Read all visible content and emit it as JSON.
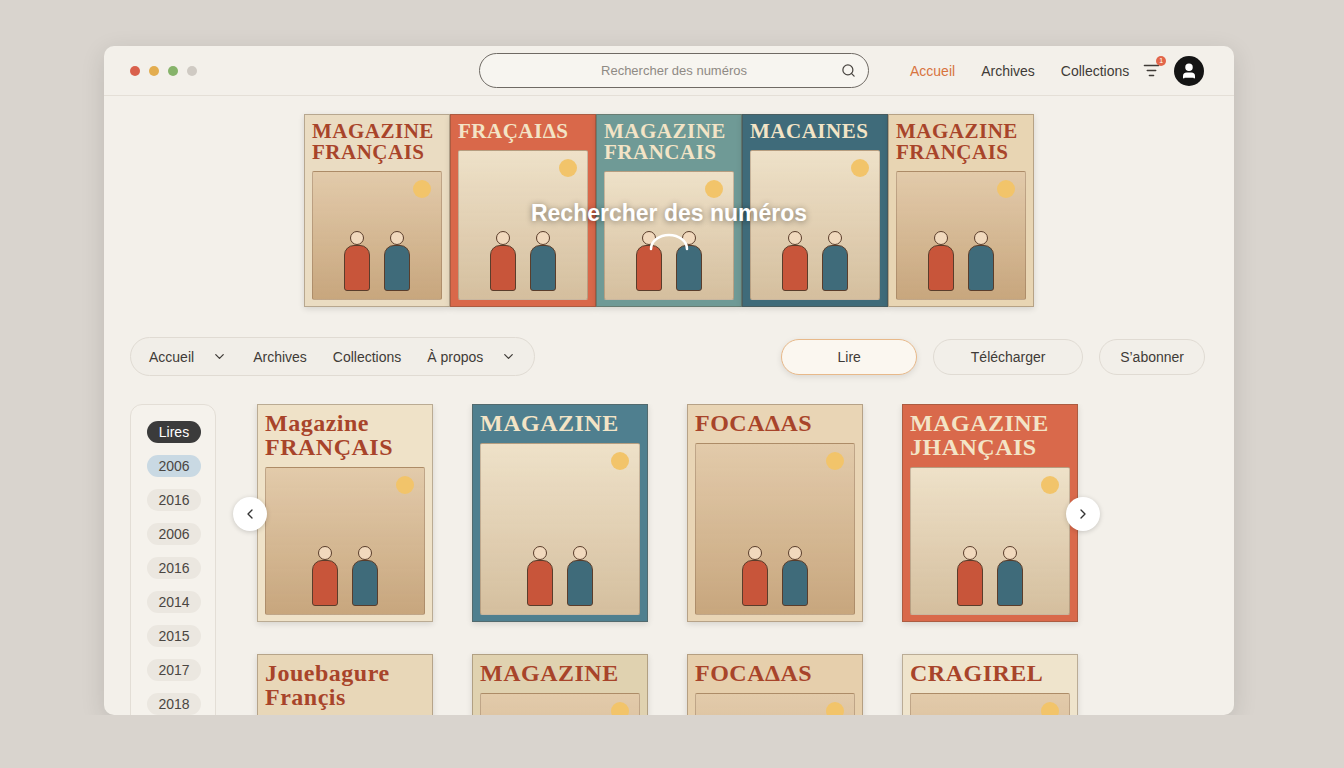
{
  "window": {
    "controls": [
      {
        "color": "#d9604c"
      },
      {
        "color": "#e3ad4f"
      },
      {
        "color": "#86b36a"
      },
      {
        "color": "#cfcac3"
      }
    ]
  },
  "search": {
    "placeholder": "Rechercher des numéros"
  },
  "top_nav": [
    {
      "label": "Accueil",
      "selected": true
    },
    {
      "label": "Archives",
      "selected": false
    },
    {
      "label": "Collections",
      "selected": false
    }
  ],
  "filter_badge": "1",
  "hero": {
    "overlay": "Rechercher des numéros",
    "loading": true,
    "covers": [
      {
        "title": "MAGAZINE FRANÇAIS",
        "color": "#eadcc2"
      },
      {
        "title": "FRAÇAIΔS",
        "color": "#d9684a"
      },
      {
        "title": "MAGAZINE FRANCAIS",
        "color": "#6f9a96"
      },
      {
        "title": "MACAINES",
        "color": "#3f6b7a"
      },
      {
        "title": "MAGAZINE FRANÇAIS",
        "color": "#e8d5b3"
      }
    ]
  },
  "nav_pills": [
    {
      "label": "Accueil",
      "dropdown": true
    },
    {
      "label": "Archives",
      "dropdown": false
    },
    {
      "label": "Collections",
      "dropdown": false
    },
    {
      "label": "À propos",
      "dropdown": true
    }
  ],
  "actions": [
    {
      "label": "Lire",
      "selected": true
    },
    {
      "label": "Télécharger",
      "selected": false
    },
    {
      "label": "S’abonner",
      "selected": false
    }
  ],
  "sidebar": {
    "items": [
      {
        "label": "Lires",
        "kind": "heading",
        "selected": false
      },
      {
        "label": "2006",
        "kind": "year",
        "selected": true
      },
      {
        "label": "2016",
        "kind": "year",
        "selected": false
      },
      {
        "label": "2006",
        "kind": "year",
        "selected": false
      },
      {
        "label": "2016",
        "kind": "year",
        "selected": false
      },
      {
        "label": "2014",
        "kind": "year",
        "selected": false
      },
      {
        "label": "2015",
        "kind": "year",
        "selected": false
      },
      {
        "label": "2017",
        "kind": "year",
        "selected": false
      },
      {
        "label": "2018",
        "kind": "year",
        "selected": false
      }
    ]
  },
  "grid": {
    "covers": [
      {
        "title": "Magazine FRANÇAIS",
        "color": "#efe2c8"
      },
      {
        "title": "MAGAZINE",
        "color": "#4f7f8f"
      },
      {
        "title": "FOCAΔAS",
        "color": "#e9d5b5"
      },
      {
        "title": "MAGAZINE JHANÇAIS",
        "color": "#d9694b"
      },
      {
        "title": "Jouebagure Françis",
        "color": "#e8d7b8"
      },
      {
        "title": "MAGAZINE",
        "color": "#e0d2b0"
      },
      {
        "title": "FOCAΔAS",
        "color": "#e6cfac"
      },
      {
        "title": "CRAGIREL",
        "color": "#efe4cc"
      }
    ]
  }
}
